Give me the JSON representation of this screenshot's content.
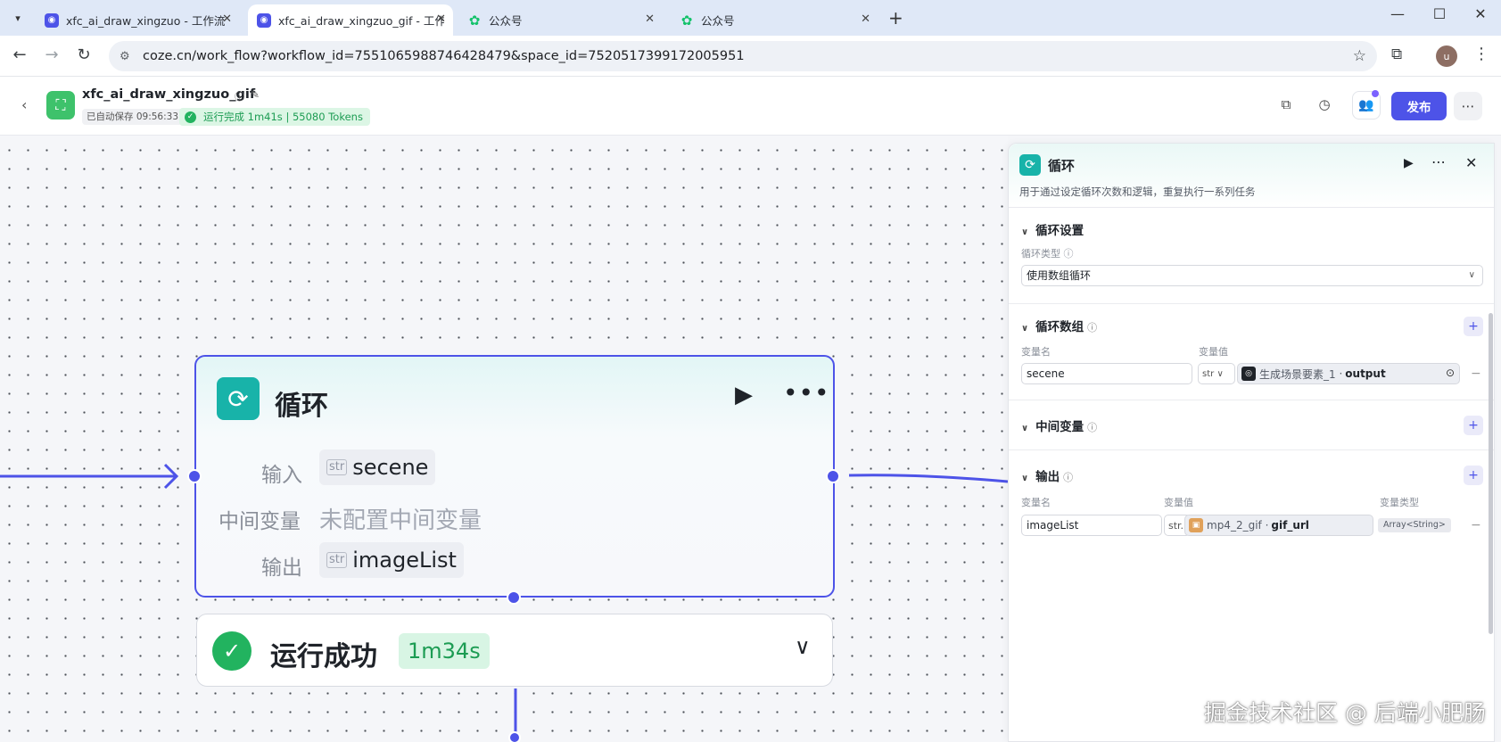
{
  "browser": {
    "tabs": [
      {
        "title": "xfc_ai_draw_xingzuo - 工作流",
        "icon": "coze-favicon"
      },
      {
        "title": "xfc_ai_draw_xingzuo_gif - 工作",
        "icon": "coze-favicon"
      },
      {
        "title": "公众号",
        "icon": "wechat-official-favicon"
      },
      {
        "title": "公众号",
        "icon": "wechat-official-favicon"
      }
    ],
    "url": "coze.cn/work_flow?workflow_id=7551065988746428479&space_id=7520517399172005951",
    "profile_initial": "u"
  },
  "header": {
    "workflow_name": "xfc_ai_draw_xingzuo_gif",
    "autosave": "已自动保存 09:56:33",
    "run_status": "运行完成 1m41s | 55080 Tokens",
    "publish_label": "发布"
  },
  "node": {
    "title": "循环",
    "input_label": "输入",
    "input_type": "str",
    "input_value": "secene",
    "intermediate_label": "中间变量",
    "intermediate_value": "未配置中间变量",
    "output_label": "输出",
    "output_type": "str",
    "output_value": "imageList",
    "result_text": "运行成功",
    "result_duration": "1m34s"
  },
  "panel": {
    "title": "循环",
    "description": "用于通过设定循环次数和逻辑，重复执行一系列任务",
    "loop_settings": {
      "title": "循环设置",
      "type_label": "循环类型",
      "type_value": "使用数组循环"
    },
    "loop_array": {
      "title": "循环数组",
      "var_name_label": "变量名",
      "var_value_label": "变量值",
      "var_name": "secene",
      "var_type": "str",
      "ref_node": "生成场景要素_1",
      "ref_field": "output"
    },
    "intermediate": {
      "title": "中间变量"
    },
    "output": {
      "title": "输出",
      "var_name_label": "变量名",
      "var_value_label": "变量值",
      "var_type_label": "变量类型",
      "var_name": "imageList",
      "var_prefix": "str.",
      "ref_node": "mp4_2_gif",
      "ref_field": "gif_url",
      "type_badge": "Array<String>"
    }
  },
  "watermark": "掘金技术社区 @ 后端小肥肠",
  "colors": {
    "accent": "#4d53e8",
    "loop_icon": "#18b3a9",
    "success": "#22b35f"
  }
}
